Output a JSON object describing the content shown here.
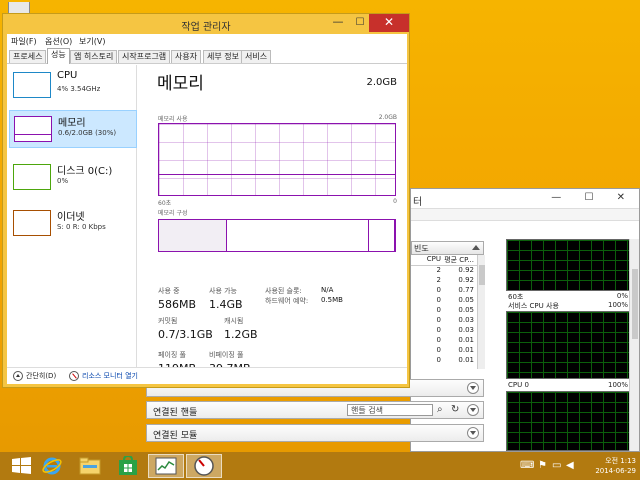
{
  "task_manager": {
    "title": "작업 관리자",
    "close_glyph": "✕",
    "min_glyph": "—",
    "max_glyph": "☐",
    "menu": [
      "파일(F)",
      "옵션(O)",
      "보기(V)"
    ],
    "tabs": [
      "프로세스",
      "성능",
      "앱 히스토리",
      "시작프로그램",
      "사용자",
      "세부 정보",
      "서비스"
    ],
    "active_tab": "성능",
    "sidebar": [
      {
        "name": "CPU",
        "sub": "4% 3.54GHz",
        "color": "#1e88c7"
      },
      {
        "name": "메모리",
        "sub": "0.6/2.0GB (30%)",
        "color": "#8b12ae"
      },
      {
        "name": "디스크 0(C:)",
        "sub": "0%",
        "color": "#4da60c"
      },
      {
        "name": "이더넷",
        "sub": "S: 0 R: 0 Kbps",
        "color": "#a74f01"
      }
    ],
    "main": {
      "title": "메모리",
      "capacity": "2.0GB",
      "usage_label": "메모리 사용",
      "usage_max": "2.0GB",
      "axis_left": "60초",
      "axis_right": "0",
      "composition_label": "메모리 구성",
      "stats": {
        "in_use_label": "사용 중",
        "in_use": "586MB",
        "available_label": "사용 가능",
        "available": "1.4GB",
        "slots_label": "사용된 슬롯:",
        "slots": "N/A",
        "hw_reserved_label": "하드웨어 예약:",
        "hw_reserved": "0.5MB",
        "committed_label": "커밋됨",
        "committed": "0.7/3.1GB",
        "cached_label": "캐시됨",
        "cached": "1.2GB",
        "paged_label": "페이징 풀",
        "paged": "119MB",
        "nonpaged_label": "비페이징 풀",
        "nonpaged": "39.7MB"
      }
    },
    "footer": {
      "fewer_details": "간단히(D)",
      "open_resmon": "리소스 모니터 열기"
    }
  },
  "resource_monitor": {
    "title_fragment": "터",
    "window_controls": "— ☐ ✕",
    "cpu_section_fragment": "빈도",
    "table_headers": [
      "CPU",
      "평균 CP..."
    ],
    "rows": [
      [
        "2",
        "0.92"
      ],
      [
        "2",
        "0.92"
      ],
      [
        "0",
        "0.77"
      ],
      [
        "0",
        "0.05"
      ],
      [
        "0",
        "0.05"
      ],
      [
        "0",
        "0.03"
      ],
      [
        "0",
        "0.03"
      ],
      [
        "0",
        "0.01"
      ],
      [
        "0",
        "0.01"
      ],
      [
        "0",
        "0.01"
      ]
    ],
    "graph_labels": [
      {
        "left": "60초",
        "right": "0%"
      },
      {
        "left": "서비스 CPU 사용",
        "right": "100%"
      },
      {
        "left": "CPU 0",
        "right": "100%"
      }
    ],
    "connected_handles": "연결된 핸들",
    "handle_search_placeholder": "핸들 검색",
    "connected_modules": "연결된 모듈"
  },
  "taskbar": {
    "time": "오전 1:13",
    "date": "2014-06-29"
  }
}
